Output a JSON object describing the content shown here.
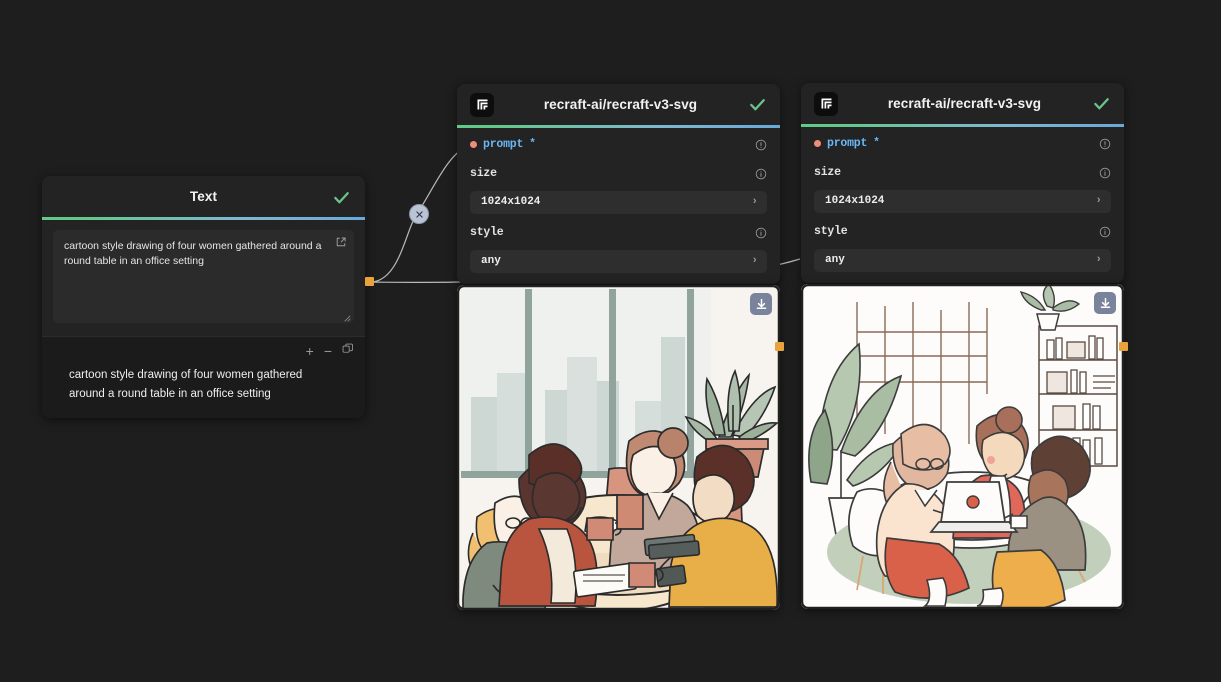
{
  "canvas": {
    "background": "#1e1e1e",
    "accent_port": "#e8a33d",
    "accent_check": "#6cc389",
    "accent_prompt": "#6ab7f5"
  },
  "text_node": {
    "title": "Text",
    "status_icon": "check-icon",
    "textarea_value": "cartoon style drawing of four women gathered around a round table in an office setting",
    "textarea_expand_icon": "external-link-icon",
    "resize_handle_icon": "resize-grip-icon",
    "tools": {
      "add_label": "+",
      "remove_label": "−",
      "copy_icon": "copy-icon"
    },
    "output_text": "cartoon style drawing of four women gathered around a round table in an office setting"
  },
  "model_nodes": [
    {
      "logo_icon": "recraft-logo-icon",
      "title": "recraft-ai/recraft-v3-svg",
      "status_icon": "check-icon",
      "fields": [
        {
          "name": "prompt",
          "label": "prompt",
          "required": true,
          "kind": "connection",
          "info_icon": "info-icon"
        },
        {
          "name": "size",
          "label": "size",
          "required": false,
          "kind": "select",
          "value": "1024x1024",
          "info_icon": "info-icon",
          "chevron_icon": "chevron-right-icon"
        },
        {
          "name": "style",
          "label": "style",
          "required": false,
          "kind": "select",
          "value": "any",
          "info_icon": "info-icon",
          "chevron_icon": "chevron-right-icon"
        }
      ],
      "result": {
        "download_icon": "download-icon",
        "alt": "cartoon illustration of four women around a round table in an office with windows and a potted plant"
      }
    },
    {
      "logo_icon": "recraft-logo-icon",
      "title": "recraft-ai/recraft-v3-svg",
      "status_icon": "check-icon",
      "fields": [
        {
          "name": "prompt",
          "label": "prompt",
          "required": true,
          "kind": "connection",
          "info_icon": "info-icon"
        },
        {
          "name": "size",
          "label": "size",
          "required": false,
          "kind": "select",
          "value": "1024x1024",
          "info_icon": "info-icon",
          "chevron_icon": "chevron-right-icon"
        },
        {
          "name": "style",
          "label": "style",
          "required": false,
          "kind": "select",
          "value": "any",
          "info_icon": "info-icon",
          "chevron_icon": "chevron-right-icon"
        }
      ],
      "result": {
        "download_icon": "download-icon",
        "alt": "line-art illustration of three women with a laptop at a round table near a bookshelf and window"
      }
    }
  ],
  "edges": {
    "delete_button_label": "✕",
    "delete_button_name": "edge-delete-button"
  }
}
